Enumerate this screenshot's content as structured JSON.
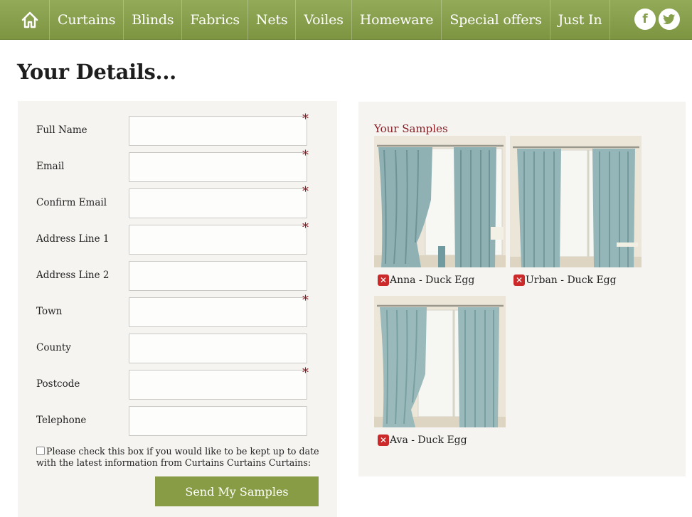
{
  "nav": {
    "home_icon": "home-icon",
    "items": [
      "Curtains",
      "Blinds",
      "Fabrics",
      "Nets",
      "Voiles",
      "Homeware",
      "Special offers",
      "Just In"
    ],
    "social": [
      "facebook-icon",
      "twitter-icon"
    ],
    "color": "#87a04b"
  },
  "page": {
    "title": "Your Details..."
  },
  "form": {
    "fields": [
      {
        "label": "Full Name",
        "required": true,
        "value": ""
      },
      {
        "label": "Email",
        "required": true,
        "value": ""
      },
      {
        "label": "Confirm Email",
        "required": true,
        "value": ""
      },
      {
        "label": "Address Line 1",
        "required": true,
        "value": ""
      },
      {
        "label": "Address Line 2",
        "required": false,
        "value": ""
      },
      {
        "label": "Town",
        "required": true,
        "value": ""
      },
      {
        "label": "County",
        "required": false,
        "value": ""
      },
      {
        "label": "Postcode",
        "required": true,
        "value": ""
      },
      {
        "label": "Telephone",
        "required": false,
        "value": ""
      }
    ],
    "required_marker": "*",
    "optin_text": "Please check this box if you would like to be kept up to date with the latest information from Curtains Curtains Curtains:",
    "optin_checked": false,
    "submit_label": "Send My Samples"
  },
  "samples": {
    "title": "Your Samples",
    "items": [
      {
        "name": "Anna - Duck Egg",
        "remove_icon": "remove-icon"
      },
      {
        "name": "Urban - Duck Egg",
        "remove_icon": "remove-icon"
      },
      {
        "name": "Ava - Duck Egg",
        "remove_icon": "remove-icon"
      }
    ]
  }
}
